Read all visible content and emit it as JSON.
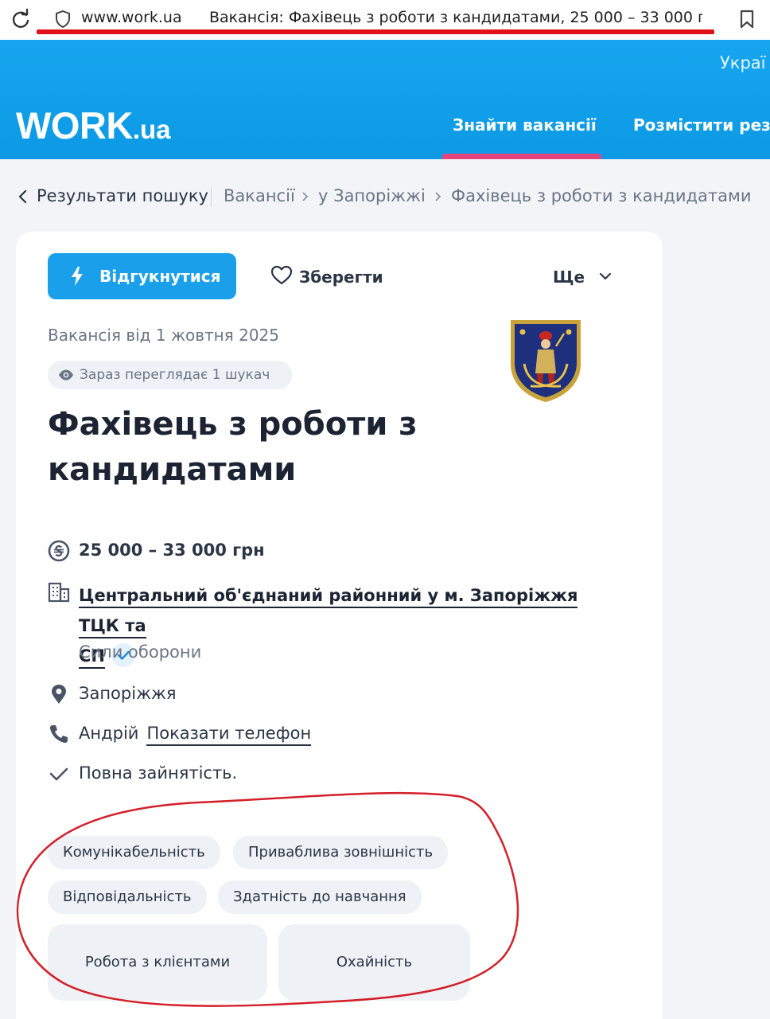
{
  "browser": {
    "url": "www.work.ua",
    "tab_title": "Вакансія: Фахівець з роботи з кандидатами, 25 000 – 33 000 г..."
  },
  "header": {
    "language": "Украї",
    "logo_main": "WORK",
    "logo_tld": ".ua",
    "nav_find": "Знайти вакансії",
    "nav_post": "Розмістити резю"
  },
  "breadcrumb": {
    "back": "Результати пошуку",
    "items": [
      "Вакансії",
      "у Запоріжжі",
      "Фахівець з роботи з кандидатами"
    ]
  },
  "actions": {
    "apply": "Відгукнутися",
    "save": "Зберегти",
    "more": "Ще"
  },
  "vacancy": {
    "posted": "Вакансія від 1 жовтня 2025",
    "viewers": "Зараз переглядає 1 шукач",
    "title": "Фахівець з роботи з кандидатами",
    "salary": "25 000 – 33 000 грн",
    "company_line1": "Центральний об'єднаний районний у м. Запоріжжя ТЦК та",
    "company_line2": "СП",
    "company_category": "Сили оборони",
    "city": "Запоріжжя",
    "contact_name": "Андрій",
    "show_phone": "Показати телефон",
    "employment": "Повна зайнятість."
  },
  "skills": [
    "Комунікабельність",
    "Приваблива зовнішність",
    "Відповідальність",
    "Здатність до навчання",
    "Робота з клієнтами",
    "Охайність"
  ],
  "colors": {
    "brand_blue": "#16a6ee",
    "apply_blue": "#1aa0ea",
    "nav_underline": "#e4457c",
    "annotation_red": "#d4202a"
  }
}
